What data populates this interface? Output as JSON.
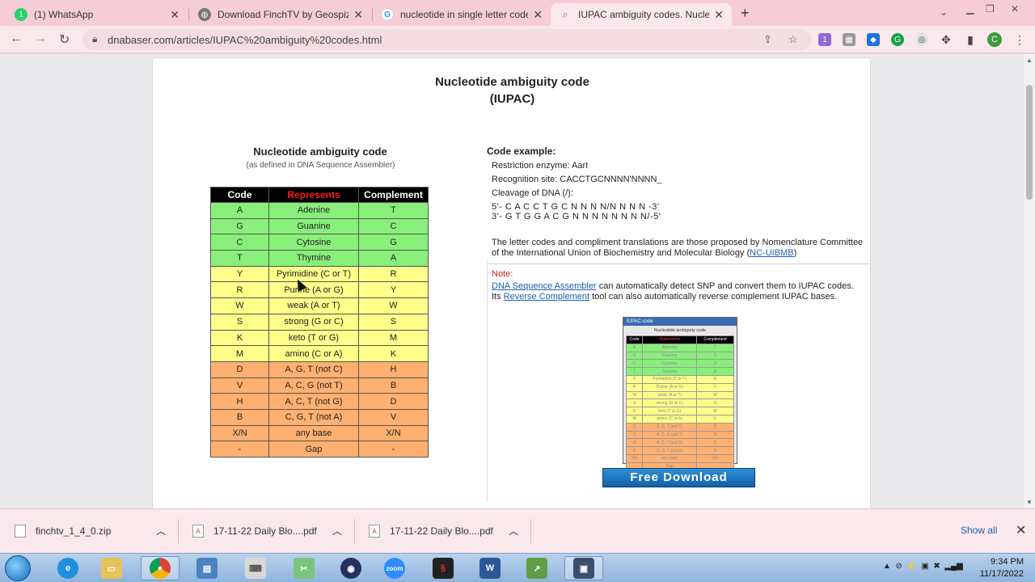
{
  "browser": {
    "tabs": [
      {
        "label": "(1) WhatsApp",
        "favicon": "whatsapp-icon",
        "color": "#25d366"
      },
      {
        "label": "Download FinchTV by Geospiza",
        "favicon": "globe-icon",
        "color": "#777777"
      },
      {
        "label": "nucleotide in single letter code -",
        "favicon": "google-icon",
        "color": "#4285f4"
      },
      {
        "label": "IUPAC ambiguity codes. Nucleot",
        "favicon": "search-icon",
        "color": "#6b8fb3"
      }
    ],
    "url": "dnabaser.com/articles/IUPAC%20ambiguity%20codes.html",
    "profile_initial": "C"
  },
  "page": {
    "title_line1": "Nucleotide ambiguity code",
    "title_line2": "(IUPAC)",
    "table_title": "Nucleotide ambiguity code",
    "table_subtitle": "(as defined in DNA Sequence Assembler)",
    "table_headers": [
      "Code",
      "Represents",
      "Complement"
    ],
    "table_rows": [
      {
        "code": "A",
        "represents": "Adenine",
        "complement": "T",
        "group": "g"
      },
      {
        "code": "G",
        "represents": "Guanine",
        "complement": "C",
        "group": "g"
      },
      {
        "code": "C",
        "represents": "Cytosine",
        "complement": "G",
        "group": "g"
      },
      {
        "code": "T",
        "represents": "Thymine",
        "complement": "A",
        "group": "g"
      },
      {
        "code": "Y",
        "represents": "Pyrimidine (C or T)",
        "complement": "R",
        "group": "y"
      },
      {
        "code": "R",
        "represents": "Purine (A or G)",
        "complement": "Y",
        "group": "y"
      },
      {
        "code": "W",
        "represents": "weak (A or T)",
        "complement": "W",
        "group": "y"
      },
      {
        "code": "S",
        "represents": "strong (G or C)",
        "complement": "S",
        "group": "y"
      },
      {
        "code": "K",
        "represents": "keto (T or G)",
        "complement": "M",
        "group": "y"
      },
      {
        "code": "M",
        "represents": "amino (C or A)",
        "complement": "K",
        "group": "y"
      },
      {
        "code": "D",
        "represents": "A, G, T (not C)",
        "complement": "H",
        "group": "o"
      },
      {
        "code": "V",
        "represents": "A, C, G (not T)",
        "complement": "B",
        "group": "o"
      },
      {
        "code": "H",
        "represents": "A, C, T (not G)",
        "complement": "D",
        "group": "o"
      },
      {
        "code": "B",
        "represents": "C, G, T (not A)",
        "complement": "V",
        "group": "o"
      },
      {
        "code": "X/N",
        "represents": "any base",
        "complement": "X/N",
        "group": "o"
      },
      {
        "code": "-",
        "represents": "Gap",
        "complement": "-",
        "group": "o"
      }
    ],
    "example": {
      "heading": "Code example:",
      "enzyme": "Restriction enzyme: AarI",
      "site": "Recognition site: CACCTGCNNNN'NNNN_",
      "cleavage": "Cleavage of DNA (/):",
      "seq1": "5'- C A C C T  G C N N N N/N N N N -3'",
      "seq2": "3'- G T G G A C G N N N N N N N N/-5'",
      "letter_codes_text": "The letter codes and compliment translations are those proposed by Nomenclature Committee of the International Union of Biochemistry and Molecular Biology (",
      "letter_codes_link": "NC-UIBMB",
      "letter_codes_end": ")",
      "note_label": "Note:",
      "note_link1": "DNA Sequence Assembler",
      "note_text1": " can automatically detect SNP and convert them to IUPAC codes.",
      "note_text2_pre": "Its ",
      "note_link2": "Reverse Complement",
      "note_text2": " tool can also automatically reverse complement IUPAC bases."
    },
    "screenshot_window_title": "IUPAC code",
    "screenshot_title": "Nucleotide ambiguity code",
    "download_button": "Free Download"
  },
  "downloads": [
    {
      "name": "finchtv_1_4_0.zip",
      "icon": "file-icon"
    },
    {
      "name": "17-11-22 Daily Blo....pdf",
      "icon": "pdf-icon"
    },
    {
      "name": "17-11-22 Daily Blo....pdf",
      "icon": "pdf-icon"
    }
  ],
  "downloads_show_all": "Show all",
  "taskbar": {
    "time": "9:34 PM",
    "date": "11/17/2022"
  }
}
